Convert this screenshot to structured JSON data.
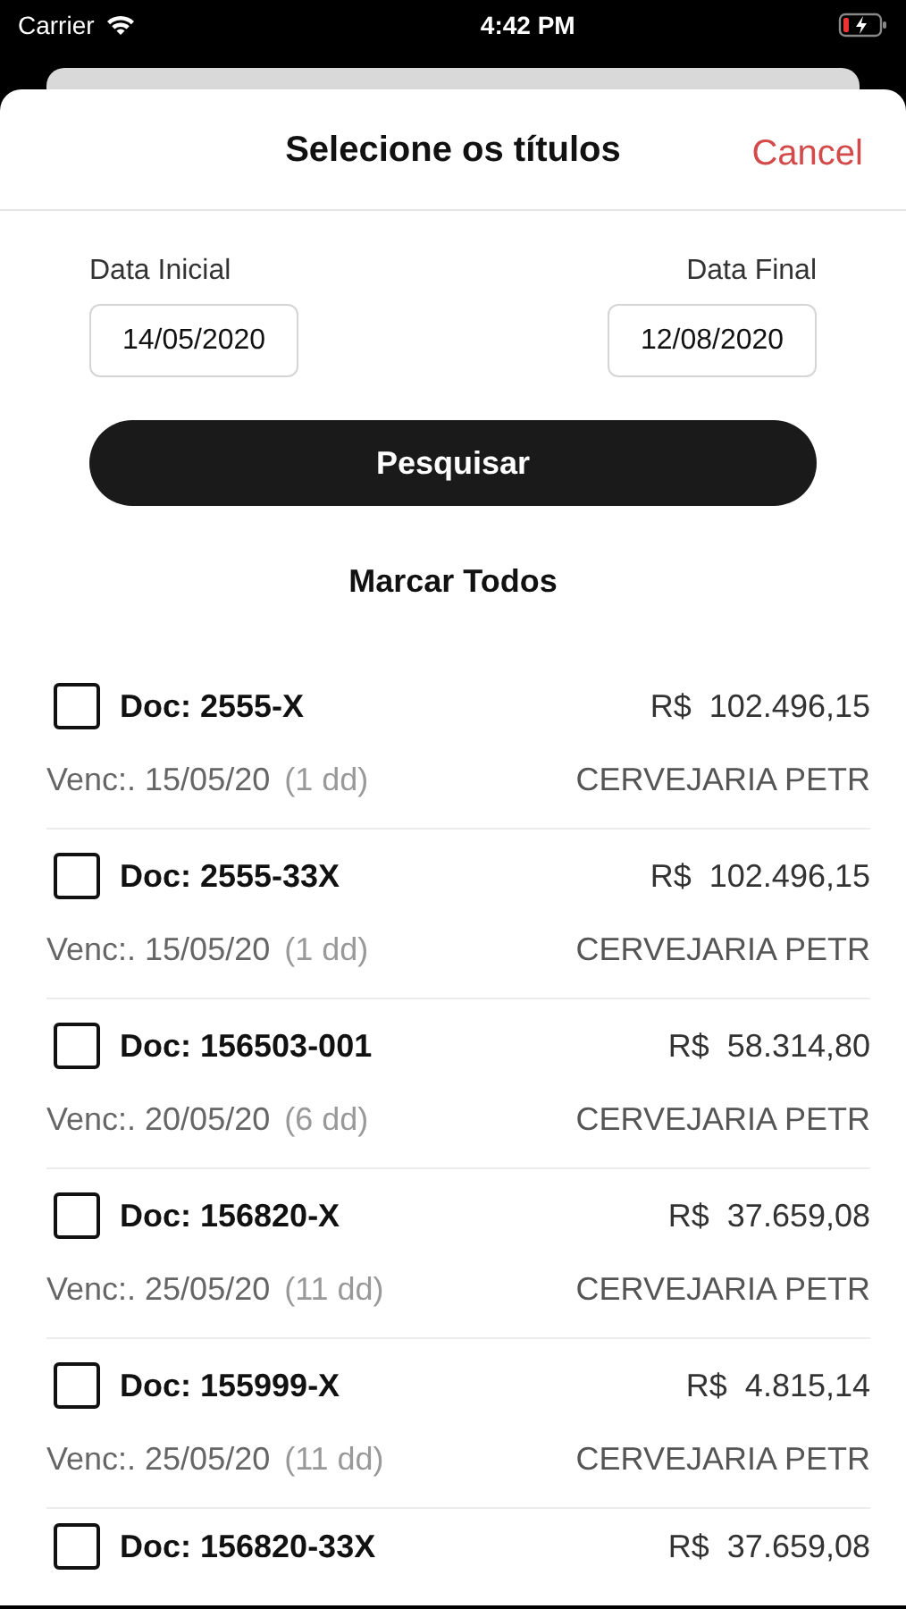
{
  "status_bar": {
    "carrier": "Carrier",
    "time": "4:42 PM"
  },
  "header": {
    "title": "Selecione os títulos",
    "cancel": "Cancel"
  },
  "filters": {
    "start_label": "Data Inicial",
    "start_value": "14/05/2020",
    "end_label": "Data Final",
    "end_value": "12/08/2020"
  },
  "search_button": "Pesquisar",
  "select_all": "Marcar Todos",
  "items": [
    {
      "doc": "Doc: 2555-X",
      "amount": "R$  102.496,15",
      "due": "Venc:. 15/05/20",
      "days": "(1 dd)",
      "company": "CERVEJARIA PETR",
      "checked": false
    },
    {
      "doc": "Doc: 2555-33X",
      "amount": "R$  102.496,15",
      "due": "Venc:. 15/05/20",
      "days": "(1 dd)",
      "company": "CERVEJARIA PETR",
      "checked": false
    },
    {
      "doc": "Doc: 156503-001",
      "amount": "R$  58.314,80",
      "due": "Venc:. 20/05/20",
      "days": "(6 dd)",
      "company": "CERVEJARIA PETR",
      "checked": false
    },
    {
      "doc": "Doc: 156820-X",
      "amount": "R$  37.659,08",
      "due": "Venc:. 25/05/20",
      "days": "(11 dd)",
      "company": "CERVEJARIA PETR",
      "checked": false
    },
    {
      "doc": "Doc: 155999-X",
      "amount": "R$  4.815,14",
      "due": "Venc:. 25/05/20",
      "days": "(11 dd)",
      "company": "CERVEJARIA PETR",
      "checked": false
    },
    {
      "doc": "Doc: 156820-33X",
      "amount": "R$  37.659,08",
      "checked": false
    }
  ]
}
